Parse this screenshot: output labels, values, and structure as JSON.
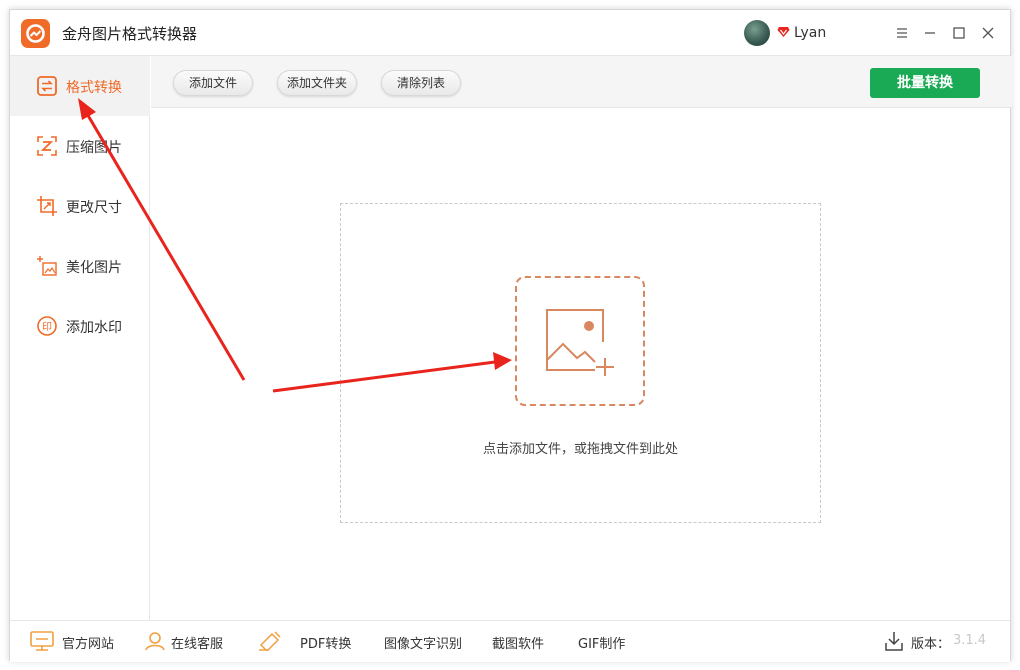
{
  "app": {
    "title": "金舟图片格式转换器"
  },
  "user": {
    "name": "Lyan"
  },
  "colors": {
    "accent": "#f06a28",
    "primary": "#1aaa55",
    "arrow": "#e8241c"
  },
  "sidebar": {
    "items": [
      {
        "label": "格式转换",
        "icon": "swap-icon",
        "active": true
      },
      {
        "label": "压缩图片",
        "icon": "compress-icon",
        "active": false
      },
      {
        "label": "更改尺寸",
        "icon": "resize-icon",
        "active": false
      },
      {
        "label": "美化图片",
        "icon": "beautify-icon",
        "active": false
      },
      {
        "label": "添加水印",
        "icon": "watermark-icon",
        "active": false
      }
    ]
  },
  "toolbar": {
    "add_file": "添加文件",
    "add_folder": "添加文件夹",
    "clear_list": "清除列表",
    "batch_convert": "批量转换"
  },
  "main": {
    "drop_hint": "点击添加文件，或拖拽文件到此处"
  },
  "footer": {
    "website": "官方网站",
    "support": "在线客服",
    "pdf": "PDF转换",
    "ocr": "图像文字识别",
    "screenshot": "截图软件",
    "gif": "GIF制作",
    "version_label": "版本：",
    "version_value": "3.1.4"
  }
}
